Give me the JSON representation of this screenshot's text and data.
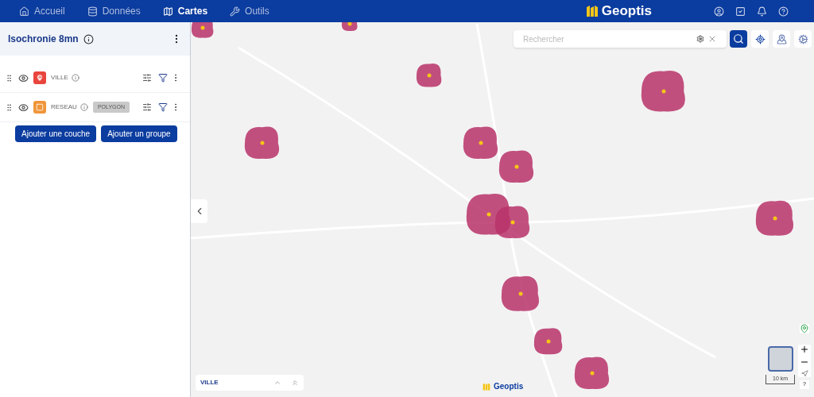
{
  "nav": {
    "items": [
      {
        "label": "Accueil",
        "selected": false,
        "kind": "home"
      },
      {
        "label": "Données",
        "selected": false,
        "kind": "data"
      },
      {
        "label": "Cartes",
        "selected": true,
        "kind": "map"
      },
      {
        "label": "Outils",
        "selected": false,
        "kind": "tools"
      }
    ],
    "brand": "Geoptis"
  },
  "panel": {
    "title": "Isochronie 8mn",
    "layers": [
      {
        "name": "VILLE",
        "kind": "point",
        "color": "#e8453c",
        "visible": true
      },
      {
        "name": "RESEAU",
        "kind": "polygon",
        "color": "#f0953a",
        "visible": true,
        "badge": "POLYGON"
      }
    ],
    "buttons": [
      "Ajouter une couche",
      "Ajouter un groupe"
    ]
  },
  "map": {
    "search": {
      "placeholder": "Rechercher"
    },
    "legend": {
      "title": "VILLE"
    },
    "scale": "10 km",
    "brand": "Geoptis",
    "help": "?"
  }
}
